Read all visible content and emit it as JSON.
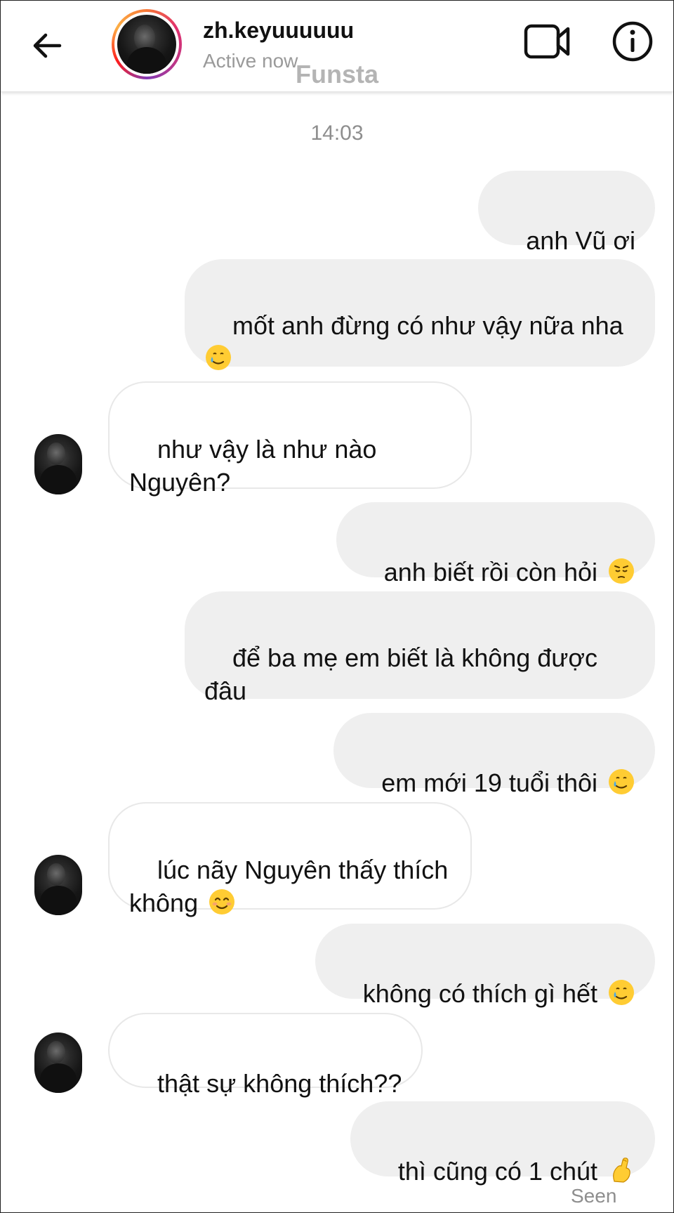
{
  "header": {
    "username": "zh.keyuuuuuu",
    "status": "Active now",
    "watermark": "Funsta"
  },
  "chat": {
    "timestamp": "14:03",
    "seen_label": "Seen",
    "messages": [
      {
        "side": "out",
        "text": "anh Vũ ơi",
        "emoji": ""
      },
      {
        "side": "out",
        "text": "mốt anh đừng có như vậy nữa nha\n",
        "emoji": "smiling-face-with-tear"
      },
      {
        "side": "in",
        "text": "như vậy là như nào\nNguyên?",
        "emoji": ""
      },
      {
        "side": "out",
        "text": "anh biết rồi còn hỏi ",
        "emoji": "pensive-face"
      },
      {
        "side": "out",
        "text": "để ba mẹ em biết là không được\nđâu",
        "emoji": ""
      },
      {
        "side": "out",
        "text": "em mới 19 tuổi thôi ",
        "emoji": "smiling-face-with-tear"
      },
      {
        "side": "in",
        "text": "lúc nãy Nguyên thấy thích\nkhông ",
        "emoji": "smiling-face"
      },
      {
        "side": "out",
        "text": "không có thích gì hết ",
        "emoji": "smiling-face-with-tear"
      },
      {
        "side": "in",
        "text": "thật sự không thích??",
        "emoji": ""
      },
      {
        "side": "out",
        "text": "thì cũng có 1 chút ",
        "emoji": "pinching-hand"
      }
    ]
  },
  "colors": {
    "outgoing_bubble": "#efefef",
    "incoming_border": "#e8e8e8",
    "muted_text": "#8e8e8e"
  }
}
